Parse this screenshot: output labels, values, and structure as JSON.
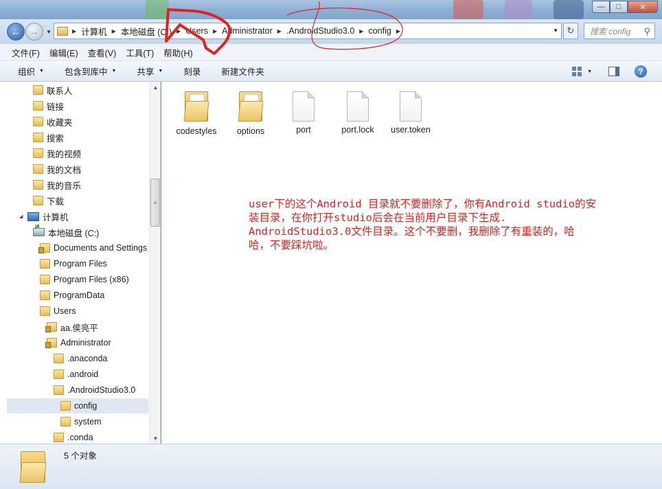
{
  "window": {
    "buttons": {
      "minimize": "—",
      "maximize": "□",
      "close": "✕"
    }
  },
  "address": {
    "crumbs": [
      "计算机",
      "本地磁盘 (C:)",
      "Users",
      "Administrator",
      ".AndroidStudio3.0",
      "config"
    ],
    "search_placeholder": "搜索 config"
  },
  "menubar": {
    "items": [
      "文件(F)",
      "编辑(E)",
      "查看(V)",
      "工具(T)",
      "帮助(H)"
    ]
  },
  "toolbar": {
    "organize": "组织",
    "include_library": "包含到库中",
    "share": "共享",
    "burn": "刻录",
    "new_folder": "新建文件夹"
  },
  "nav": {
    "items": [
      {
        "label": "联系人"
      },
      {
        "label": "链接"
      },
      {
        "label": "收藏夹"
      },
      {
        "label": "搜索"
      },
      {
        "label": "我的视频"
      },
      {
        "label": "我的文档"
      },
      {
        "label": "我的音乐"
      },
      {
        "label": "下载"
      },
      {
        "label": "计算机"
      },
      {
        "label": "本地磁盘 (C:)"
      },
      {
        "label": "Documents and Settings"
      },
      {
        "label": "Program Files"
      },
      {
        "label": "Program Files (x86)"
      },
      {
        "label": "ProgramData"
      },
      {
        "label": "Users"
      },
      {
        "label": "aa.侯亮平"
      },
      {
        "label": "Administrator"
      },
      {
        "label": ".anaconda"
      },
      {
        "label": ".android"
      },
      {
        "label": ".AndroidStudio3.0"
      },
      {
        "label": "config"
      },
      {
        "label": "system"
      },
      {
        "label": ".conda"
      }
    ]
  },
  "files": [
    {
      "name": "codestyles",
      "kind": "folder"
    },
    {
      "name": "options",
      "kind": "folder"
    },
    {
      "name": "port",
      "kind": "file"
    },
    {
      "name": "port.lock",
      "kind": "file"
    },
    {
      "name": "user.token",
      "kind": "file"
    }
  ],
  "annotation": {
    "line1": "user下的这个Android 目录就不要删除了，你有Android studio的安",
    "line2": "装目录，在你打开studio后会在当前用户目录下生成.",
    "line3": "AndroidStudio3.0文件目录。这个不要删，我删除了有重装的，哈",
    "line4": "哈，不要踩坑啦。"
  },
  "status": {
    "count_text": "5 个对象"
  },
  "colors": {
    "annotation_red": "#e0221e",
    "selection": "#dfe7f1"
  }
}
